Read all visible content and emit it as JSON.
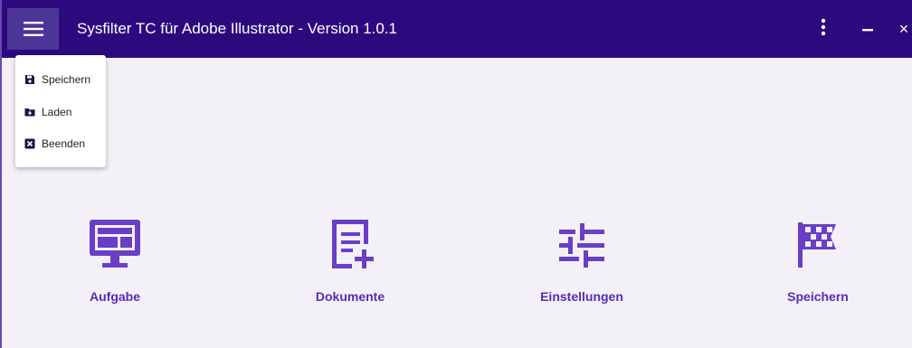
{
  "window": {
    "title": "Sysfilter TC für Adobe Illustrator - Version 1.0.1",
    "close_glyph": "×"
  },
  "titlebar": {
    "menu_icon": "hamburger-menu-icon",
    "more_icon": "more-vertical-icon",
    "minimize_icon": "minimize-icon",
    "close_icon": "close-icon"
  },
  "menu": {
    "items": [
      {
        "label": "Speichern",
        "icon": "save-icon"
      },
      {
        "label": "Laden",
        "icon": "folder-download-icon"
      },
      {
        "label": "Beenden",
        "icon": "exit-box-icon"
      }
    ]
  },
  "tiles": [
    {
      "label": "Aufgabe",
      "icon": "monitor-dashboard-icon"
    },
    {
      "label": "Dokumente",
      "icon": "document-plus-icon"
    },
    {
      "label": "Einstellungen",
      "icon": "sliders-icon"
    },
    {
      "label": "Speichern",
      "icon": "checkered-flag-icon"
    }
  ],
  "colors": {
    "titlebar": "#2c0a7e",
    "menu_button": "#4b3596",
    "accent": "#6a3fc6",
    "label": "#5a2bb5",
    "background": "#f3f1f7"
  }
}
